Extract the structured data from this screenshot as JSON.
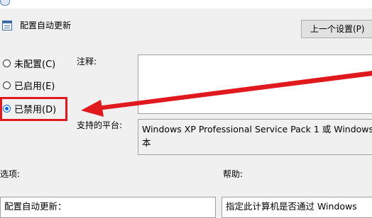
{
  "colors": {
    "annotation": "#e0191e",
    "radio_selected": "#0c63d8",
    "window_bg": "#f0f0f0"
  },
  "header": {
    "icon": "policy-setting-icon",
    "title": "配置自动更新",
    "prev_button_label": "上一个设置(P)"
  },
  "state_options": [
    {
      "label": "未配置(C)",
      "checked": false
    },
    {
      "label": "已启用(E)",
      "checked": false
    },
    {
      "label": "已禁用(D)",
      "checked": true
    }
  ],
  "comment": {
    "label": "注释:",
    "value": ""
  },
  "platform": {
    "label": "支持的平台:",
    "lines": [
      "Windows XP Professional Service Pack 1 或 Windows",
      "本"
    ]
  },
  "options": {
    "label": "选项:",
    "first_line": "配置自动更新："
  },
  "help": {
    "label": "帮助:",
    "first_line": "指定此计算机是否通过 Windows"
  },
  "annotation": {
    "arrow": "red-arrow",
    "box": "red-highlight-box"
  }
}
